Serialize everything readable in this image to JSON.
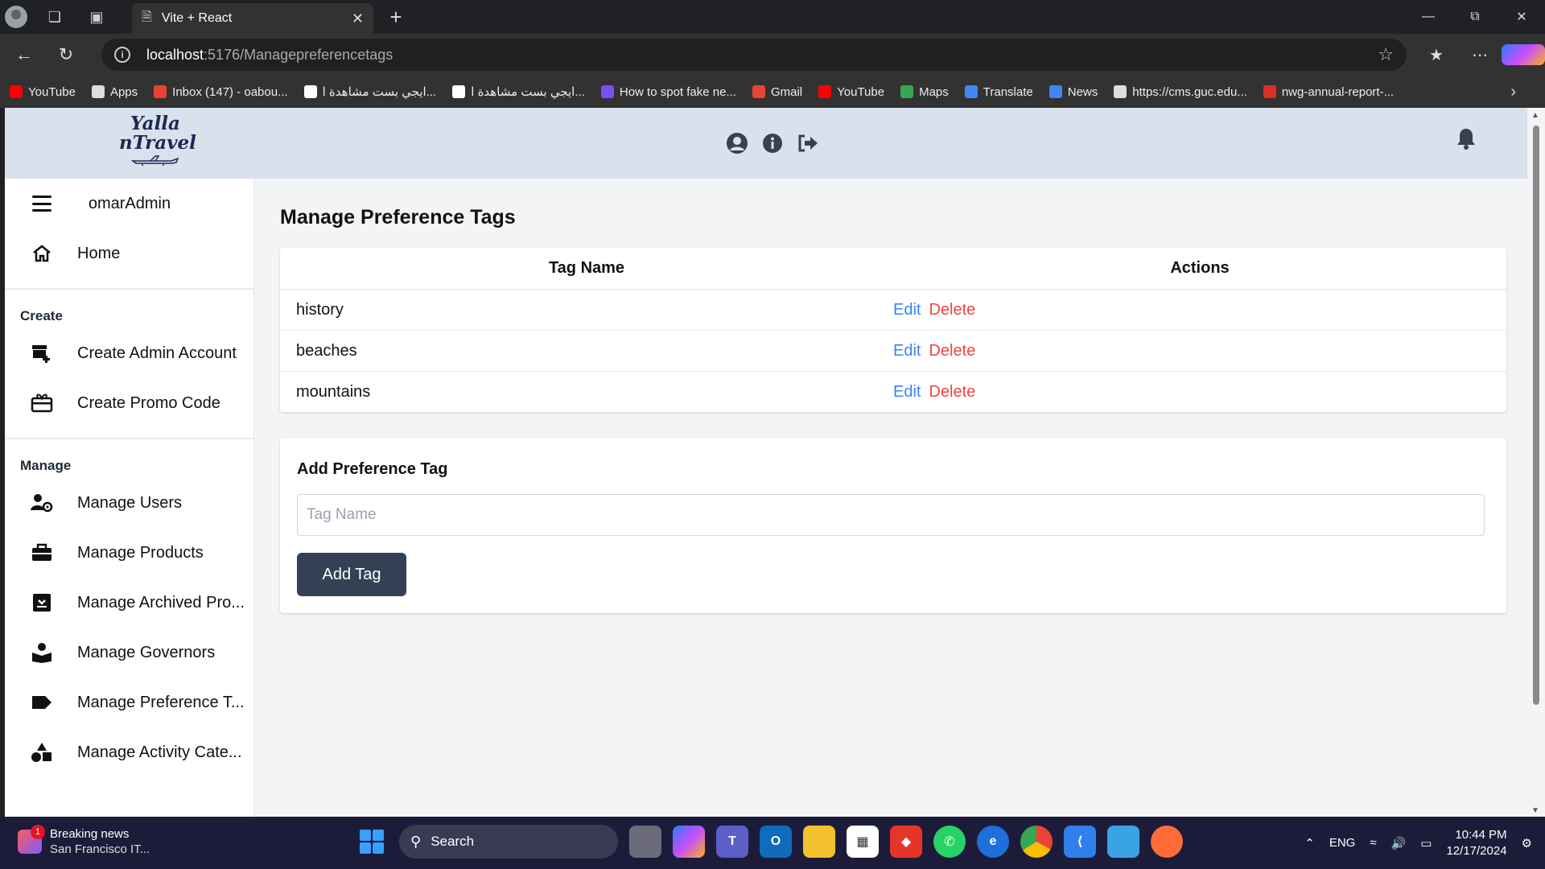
{
  "browser": {
    "tab_title": "Vite + React",
    "url_host": "localhost",
    "url_path": ":5176/Managepreferencetags",
    "bookmarks": [
      {
        "label": "YouTube",
        "color": "#ff0000"
      },
      {
        "label": "Apps",
        "color": "#dddddd"
      },
      {
        "label": "Inbox (147) - oabou...",
        "color": "#ea4335"
      },
      {
        "label": "ايجي بست مشاهدة ا...",
        "color": "#ffffff"
      },
      {
        "label": "ايجي بست مشاهدة ا...",
        "color": "#ffffff"
      },
      {
        "label": "How to spot fake ne...",
        "color": "#7b4dff"
      },
      {
        "label": "Gmail",
        "color": "#ea4335"
      },
      {
        "label": "YouTube",
        "color": "#ff0000"
      },
      {
        "label": "Maps",
        "color": "#34a853"
      },
      {
        "label": "Translate",
        "color": "#4285f4"
      },
      {
        "label": "News",
        "color": "#4285f4"
      },
      {
        "label": "https://cms.guc.edu...",
        "color": "#dddddd"
      },
      {
        "label": "nwg-annual-report-...",
        "color": "#d93025"
      }
    ]
  },
  "header": {
    "logo_line1": "Yalla",
    "logo_line2": "nTravel",
    "icons": [
      "user-circle-icon",
      "info-circle-icon",
      "logout-icon",
      "bell-icon"
    ]
  },
  "sidebar": {
    "username": "omarAdmin",
    "home_label": "Home",
    "create_section": "Create",
    "create_items": [
      {
        "label": "Create Admin Account",
        "icon": "store-plus-icon"
      },
      {
        "label": "Create Promo Code",
        "icon": "gift-card-icon"
      }
    ],
    "manage_section": "Manage",
    "manage_items": [
      {
        "label": "Manage Users",
        "icon": "users-gear-icon"
      },
      {
        "label": "Manage Products",
        "icon": "briefcase-icon"
      },
      {
        "label": "Manage Archived Pro...",
        "icon": "archive-icon"
      },
      {
        "label": "Manage Governors",
        "icon": "reader-icon"
      },
      {
        "label": "Manage Preference T...",
        "icon": "tag-icon"
      },
      {
        "label": "Manage Activity Cate...",
        "icon": "shapes-icon"
      }
    ]
  },
  "main": {
    "title": "Manage Preference Tags",
    "table": {
      "headers": [
        "Tag Name",
        "Actions"
      ],
      "rows": [
        {
          "name": "history"
        },
        {
          "name": "beaches"
        },
        {
          "name": "mountains"
        }
      ],
      "edit_label": "Edit",
      "delete_label": "Delete"
    },
    "add_form": {
      "title": "Add Preference Tag",
      "input_placeholder": "Tag Name",
      "input_value": "",
      "button_label": "Add Tag"
    }
  },
  "taskbar": {
    "news_title": "Breaking news",
    "news_sub": "San Francisco IT...",
    "news_badge": "1",
    "search_label": "Search",
    "lang": "ENG",
    "time": "10:44 PM",
    "date": "12/17/2024"
  },
  "colors": {
    "header_bg": "#d8e1ec",
    "edit": "#3b82f6",
    "delete": "#ef4444",
    "button_bg": "#334155"
  }
}
